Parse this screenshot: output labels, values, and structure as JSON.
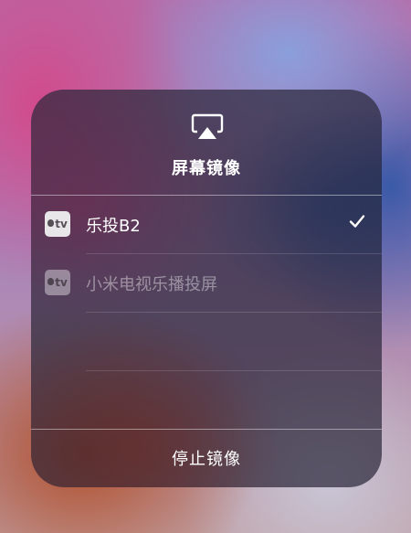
{
  "panel": {
    "title": "屏幕镜像",
    "icon": "airplay-icon"
  },
  "devices": [
    {
      "label": "乐投B2",
      "icon": "apple-tv-icon",
      "icon_text": "tv",
      "selected": true,
      "enabled": true
    },
    {
      "label": "小米电视乐播投屏",
      "icon": "apple-tv-icon",
      "icon_text": "tv",
      "selected": false,
      "enabled": false
    }
  ],
  "footer": {
    "stop_label": "停止镜像"
  },
  "colors": {
    "text": "#ffffff",
    "dim_text": "#8e8a95",
    "panel": "#2d283c"
  }
}
